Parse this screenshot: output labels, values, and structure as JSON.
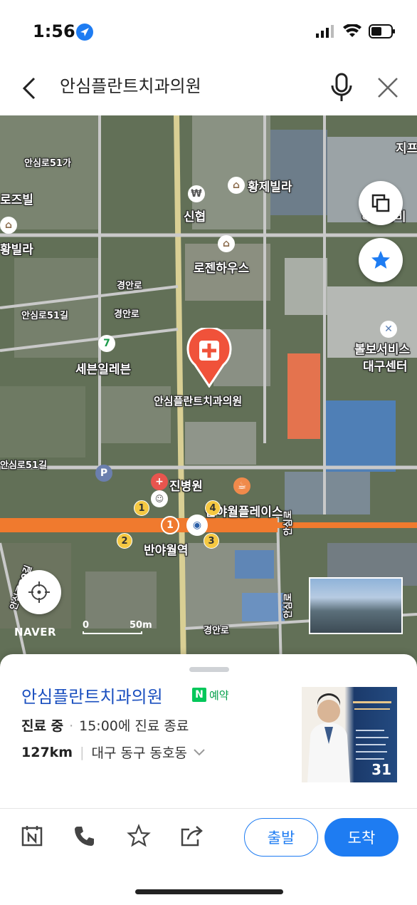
{
  "status_bar": {
    "time": "1:56"
  },
  "search": {
    "query": "안심플란트치과의원"
  },
  "map": {
    "labels": {
      "ansimro51_top": "안심로51가",
      "ruzvilla": "로즈빌",
      "hwangje": "황제빌라",
      "sinhyup": "신협",
      "hana_jeongbi": "하나정비",
      "jip": "지프",
      "jap": "자",
      "villa_left": "황빌라",
      "rojen": "로젠하우스",
      "gyeongan1": "경안로",
      "gyeongan2": "경안로",
      "ansimro51_mid": "안심로51길",
      "seven": "세븐일레븐",
      "bolbo1": "볼보서비스",
      "bolbo2": "대구센터",
      "clinic_map": "안심플란트치과의원",
      "ansimro51_low": "안심로51길",
      "jinbyungwon": "진병원",
      "place_plaza": "반야월플레이스",
      "banyawol": "반야월역",
      "ansimro_vert1": "안심로",
      "ansimro_vert2": "안심로",
      "ansimro50": "안심로50길",
      "gyeongan_bottom": "경안로"
    },
    "exits": [
      "1",
      "2",
      "3",
      "4"
    ],
    "station_line": "1",
    "brand": "NAVER",
    "scale_zero": "0",
    "scale_value": "50m"
  },
  "place": {
    "name": "안심플란트치과의원",
    "badge_label": "예약",
    "badge_icon": "N",
    "status": "진료 중",
    "status_detail": "15:00에 진료 종료",
    "distance": "127km",
    "address": "대구 동구 동호동",
    "photo_count": "31"
  },
  "actions": {
    "depart_label": "출발",
    "arrive_label": "도착"
  },
  "colors": {
    "accent": "#1e7cf2",
    "marker": "#f0523a",
    "subway": "#f07a2e",
    "naver_green": "#03c75a"
  }
}
